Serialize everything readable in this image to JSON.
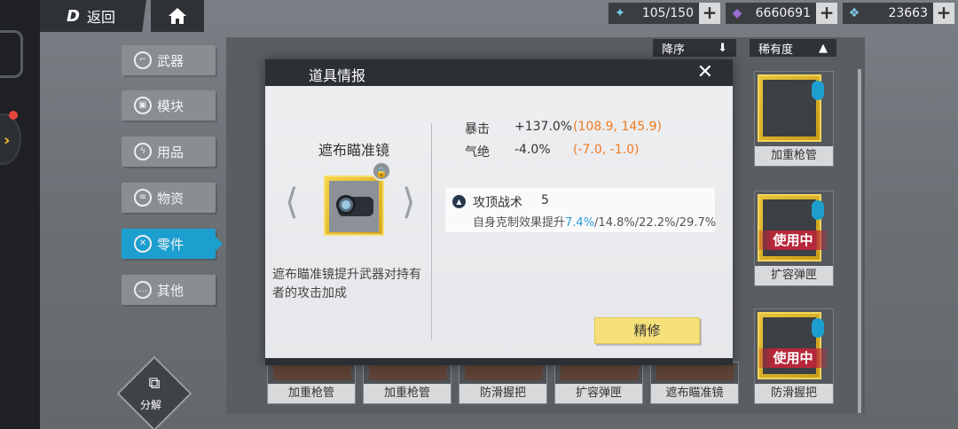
{
  "topbar": {
    "back_label": "返回",
    "back_logo": "D",
    "resources": [
      {
        "icon": "energy-icon",
        "value": "105/150"
      },
      {
        "icon": "crystal-icon",
        "value": "6660691"
      },
      {
        "icon": "coin-icon",
        "value": "23663"
      }
    ],
    "plus": "+"
  },
  "sort": {
    "order_label": "降序",
    "order_icon": "⬇",
    "rarity_label": "稀有度",
    "rarity_icon": "▲"
  },
  "menu": [
    {
      "label": "武器",
      "icon": "gun-icon",
      "active": false
    },
    {
      "label": "模块",
      "icon": "module-icon",
      "active": false
    },
    {
      "label": "用品",
      "icon": "lightning-icon",
      "active": false
    },
    {
      "label": "物资",
      "icon": "supply-icon",
      "active": false
    },
    {
      "label": "零件",
      "icon": "parts-icon",
      "active": true
    },
    {
      "label": "其他",
      "icon": "more-icon",
      "active": false
    }
  ],
  "decompose_label": "分解",
  "cards": [
    {
      "label": "加重枪管",
      "in_use": ""
    },
    {
      "label": "扩容弹匣",
      "in_use": "使用中"
    },
    {
      "label": "防滑握把",
      "in_use": "使用中"
    }
  ],
  "bottom_cards": [
    "加重枪管",
    "加重枪管",
    "防滑握把",
    "扩容弹匣",
    "遮布瞄准镜"
  ],
  "dialog": {
    "title": "道具情报",
    "item_name": "遮布瞄准镜",
    "description": "遮布瞄准镜提升武器对持有者的攻击加成",
    "stats": [
      {
        "name": "暴击",
        "value": "+137.0%",
        "range": "(108.9, 145.9)"
      },
      {
        "name": "气绝",
        "value": "-4.0%",
        "range": "(-7.0, -1.0)"
      }
    ],
    "skill": {
      "name": "攻顶战术",
      "level": "5",
      "desc_prefix": "自身克制效果提升",
      "desc_highlight": "7.4%",
      "desc_rest": "/14.8%/22.2%/29.7%"
    },
    "refine_label": "精修"
  },
  "colors": {
    "accent_blue": "#1c9fcf",
    "range_orange": "#f07a1e",
    "gold": "#f5d247",
    "in_use_red": "#b7283a"
  }
}
